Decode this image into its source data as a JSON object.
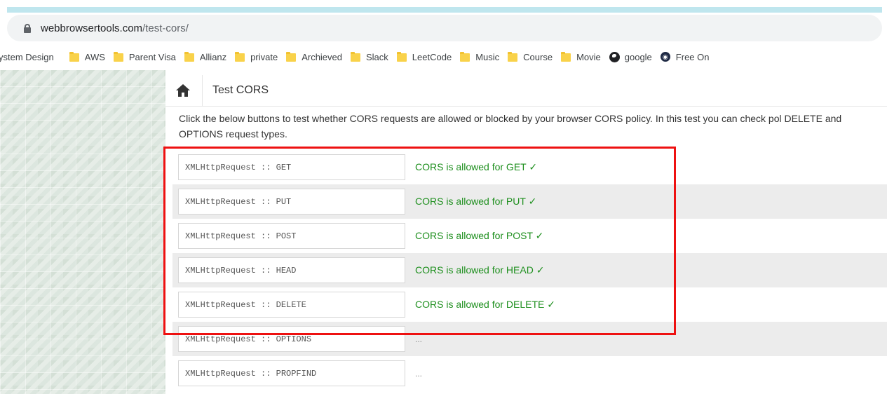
{
  "browser": {
    "url_domain": "webbrowsertools.com",
    "url_path": "/test-cors/",
    "bookmarks": [
      {
        "label": "ystem Design",
        "icon": "none"
      },
      {
        "label": "AWS",
        "icon": "folder-icon"
      },
      {
        "label": "Parent Visa",
        "icon": "folder-icon"
      },
      {
        "label": "Allianz",
        "icon": "folder-icon"
      },
      {
        "label": "private",
        "icon": "folder-icon"
      },
      {
        "label": "Archieved",
        "icon": "folder-icon"
      },
      {
        "label": "Slack",
        "icon": "folder-icon"
      },
      {
        "label": "LeetCode",
        "icon": "folder-icon"
      },
      {
        "label": "Music",
        "icon": "folder-icon"
      },
      {
        "label": "Course",
        "icon": "folder-icon"
      },
      {
        "label": "Movie",
        "icon": "folder-icon"
      },
      {
        "label": "google",
        "icon": "globe-icon"
      },
      {
        "label": "Free On",
        "icon": "site-icon"
      }
    ]
  },
  "page": {
    "title": "Test CORS",
    "description": "Click the below buttons to test whether CORS requests are allowed or blocked by your browser CORS policy. In this test you can check pol DELETE and OPTIONS request types."
  },
  "tests": [
    {
      "button": "XMLHttpRequest :: GET",
      "result": "CORS is allowed for GET ✓"
    },
    {
      "button": "XMLHttpRequest :: PUT",
      "result": "CORS is allowed for PUT ✓"
    },
    {
      "button": "XMLHttpRequest :: POST",
      "result": "CORS is allowed for POST ✓"
    },
    {
      "button": "XMLHttpRequest :: HEAD",
      "result": "CORS is allowed for HEAD ✓"
    },
    {
      "button": "XMLHttpRequest :: DELETE",
      "result": "CORS is allowed for DELETE ✓"
    },
    {
      "button": "XMLHttpRequest :: OPTIONS",
      "result": "..."
    },
    {
      "button": "XMLHttpRequest :: PROPFIND",
      "result": "..."
    }
  ],
  "colors": {
    "allowed": "#1e8f1e",
    "highlight": "#ee1111",
    "accent_bar": "#bfe6ee"
  }
}
